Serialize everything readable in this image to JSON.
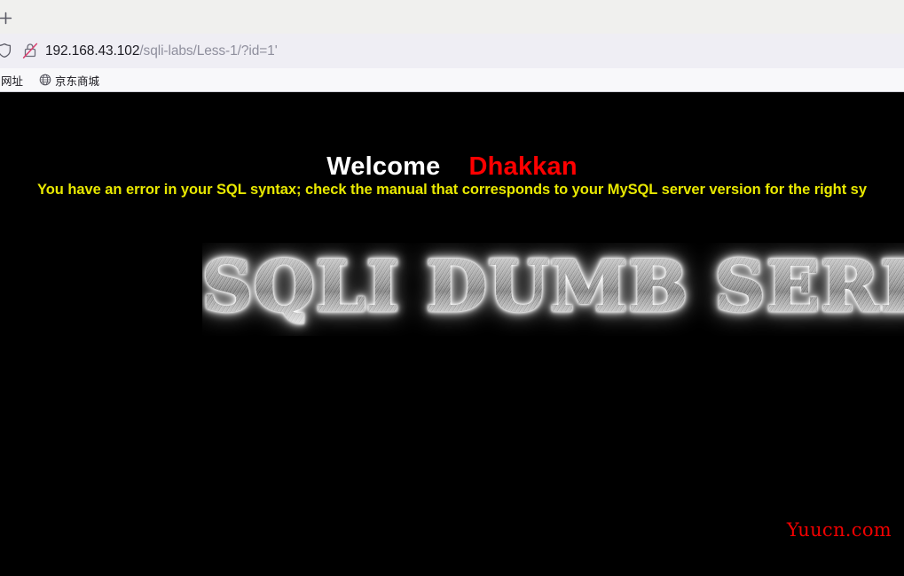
{
  "browser": {
    "new_tab_label": "+",
    "shield_icon_name": "shield-icon",
    "lock_icon_name": "lock-crossed-icon",
    "url": {
      "domain": "192.168.43.102",
      "path": "/sqli-labs/Less-1/?id=1'",
      "full": "192.168.43.102/sqli-labs/Less-1/?id=1'"
    },
    "bookmarks": [
      {
        "label": "网址",
        "icon": "bookmark-folder-icon"
      },
      {
        "label": "京东商城",
        "icon": "globe-icon"
      }
    ]
  },
  "page": {
    "welcome_text": "Welcome",
    "user_text": "Dhakkan",
    "sql_error": "You have an error in your SQL syntax; check the manual that corresponds to your MySQL server version for the right sy",
    "title": "SQLI DUMB SERIES",
    "watermark": "Yuucn.com"
  },
  "colors": {
    "page_background": "#000000",
    "welcome": "#ffffff",
    "user": "#ff0000",
    "error": "#e8e800",
    "watermark": "#ff0000",
    "chrome_tabstrip": "#f0f0ee",
    "chrome_navbar": "#efeef4",
    "chrome_bookmarks": "#f8f8fa",
    "url_domain": "#1c1b22",
    "url_path": "#8f8f9d"
  }
}
